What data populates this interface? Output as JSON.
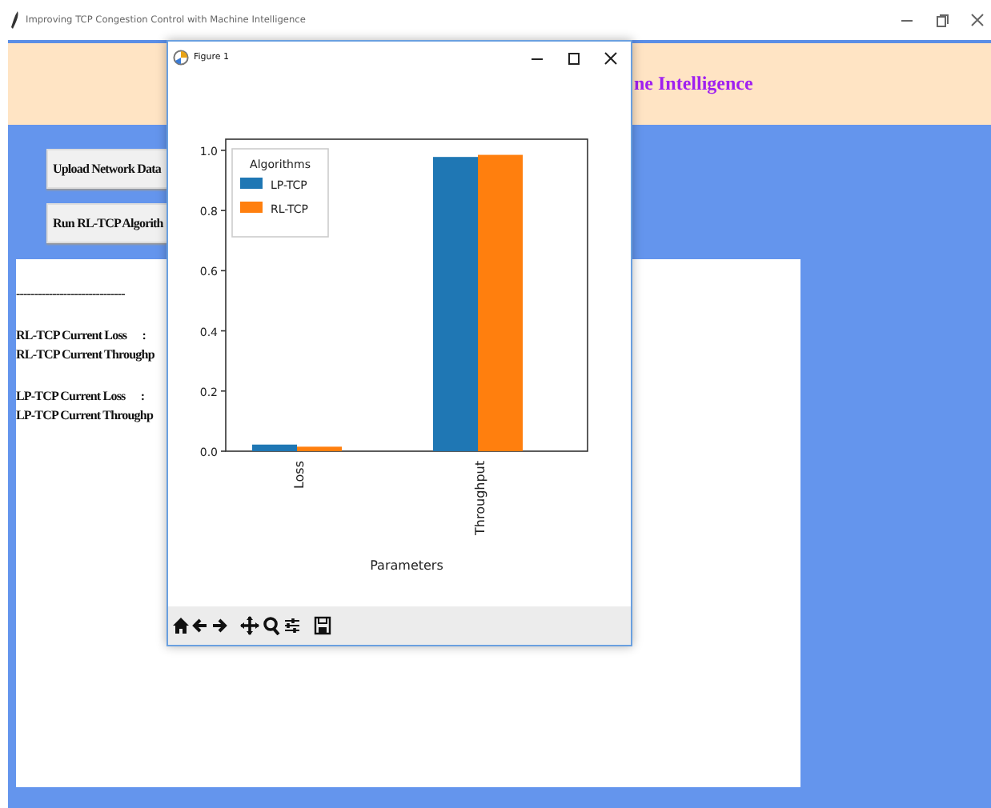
{
  "window": {
    "title": "Improving TCP Congestion Control with Machine Intelligence"
  },
  "header": {
    "title": "ne Intelligence"
  },
  "buttons": [
    "Upload Network Data",
    "Run RL-TCP Algorith"
  ],
  "output": {
    "blocks": [
      [
        "------------------------------"
      ],
      [
        "RL-TCP Current Loss      :",
        "RL-TCP Current Throughp"
      ],
      [
        "LP-TCP Current Loss      :",
        "LP-TCP Current Throughp"
      ]
    ]
  },
  "figure": {
    "title": "Figure 1",
    "legend_title": "Algorithms",
    "chart_data": {
      "type": "bar",
      "xlabel": "Parameters",
      "categories": [
        "Loss",
        "Throughput"
      ],
      "series": [
        {
          "name": "LP-TCP",
          "color": "#1f77b4",
          "values": [
            0.022,
            0.978
          ]
        },
        {
          "name": "RL-TCP",
          "color": "#ff7f0e",
          "values": [
            0.015,
            0.985
          ]
        }
      ],
      "legend": "upper left",
      "ylim": [
        0,
        1.037
      ],
      "yticks": [
        {
          "value": 0,
          "label": "0.0"
        },
        0.2,
        0.4,
        0.6,
        0.8,
        {
          "value": 1,
          "label": "1.0"
        }
      ]
    }
  }
}
